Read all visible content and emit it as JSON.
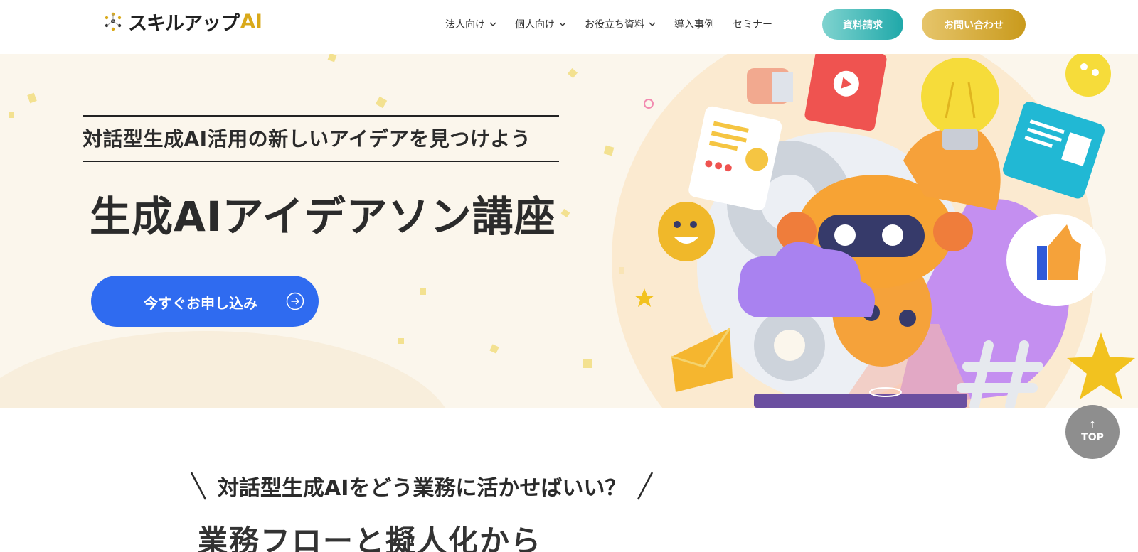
{
  "header": {
    "logo_text": "スキルアップ",
    "logo_ai": "AI",
    "nav": [
      {
        "label": "法人向け",
        "has_dropdown": true
      },
      {
        "label": "個人向け",
        "has_dropdown": true
      },
      {
        "label": "お役立ち資料",
        "has_dropdown": true
      },
      {
        "label": "導入事例",
        "has_dropdown": false
      },
      {
        "label": "セミナー",
        "has_dropdown": false
      }
    ],
    "docs_button": "資料請求",
    "contact_button": "お問い合わせ"
  },
  "hero": {
    "subtitle": "対話型生成AI活用の新しいアイデアを見つけよう",
    "title": "生成AIアイデアソン講座",
    "cta_label": "今すぐお申し込み"
  },
  "section": {
    "subheading": "対話型生成AIをどう業務に活かせばいい？",
    "heading": "業務フローと擬人化から"
  },
  "back_to_top": {
    "arrow": "↑",
    "label": "TOP"
  },
  "colors": {
    "cta_blue": "#2f6bf0",
    "docs_teal": "#1fa8a9",
    "contact_gold": "#c99a1c",
    "hero_bg": "#fbf6ec"
  }
}
